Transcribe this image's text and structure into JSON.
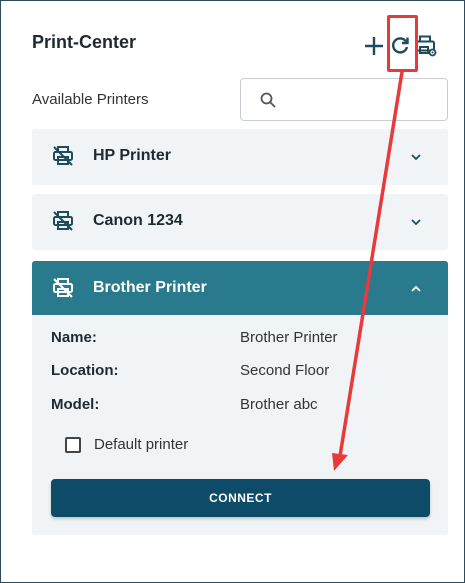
{
  "header": {
    "title": "Print-Center",
    "add_icon": "plus-icon",
    "refresh_icon": "refresh-icon",
    "settings_icon": "printer-settings-icon"
  },
  "available_label": "Available Printers",
  "search": {
    "placeholder": "",
    "value": ""
  },
  "printers": [
    {
      "name": "HP Printer",
      "expanded": false
    },
    {
      "name": "Canon 1234",
      "expanded": false
    },
    {
      "name": "Brother Printer",
      "expanded": true
    }
  ],
  "details": {
    "name_label": "Name:",
    "name_value": "Brother Printer",
    "location_label": "Location:",
    "location_value": "Second Floor",
    "model_label": "Model:",
    "model_value": "Brother abc",
    "default_label": "Default printer",
    "default_checked": false,
    "connect_label": "CONNECT"
  },
  "colors": {
    "expanded_header": "#297a8c",
    "connect_button": "#0d4b68",
    "card_bg": "#f0f4f6",
    "annotation": "#e8393b"
  }
}
